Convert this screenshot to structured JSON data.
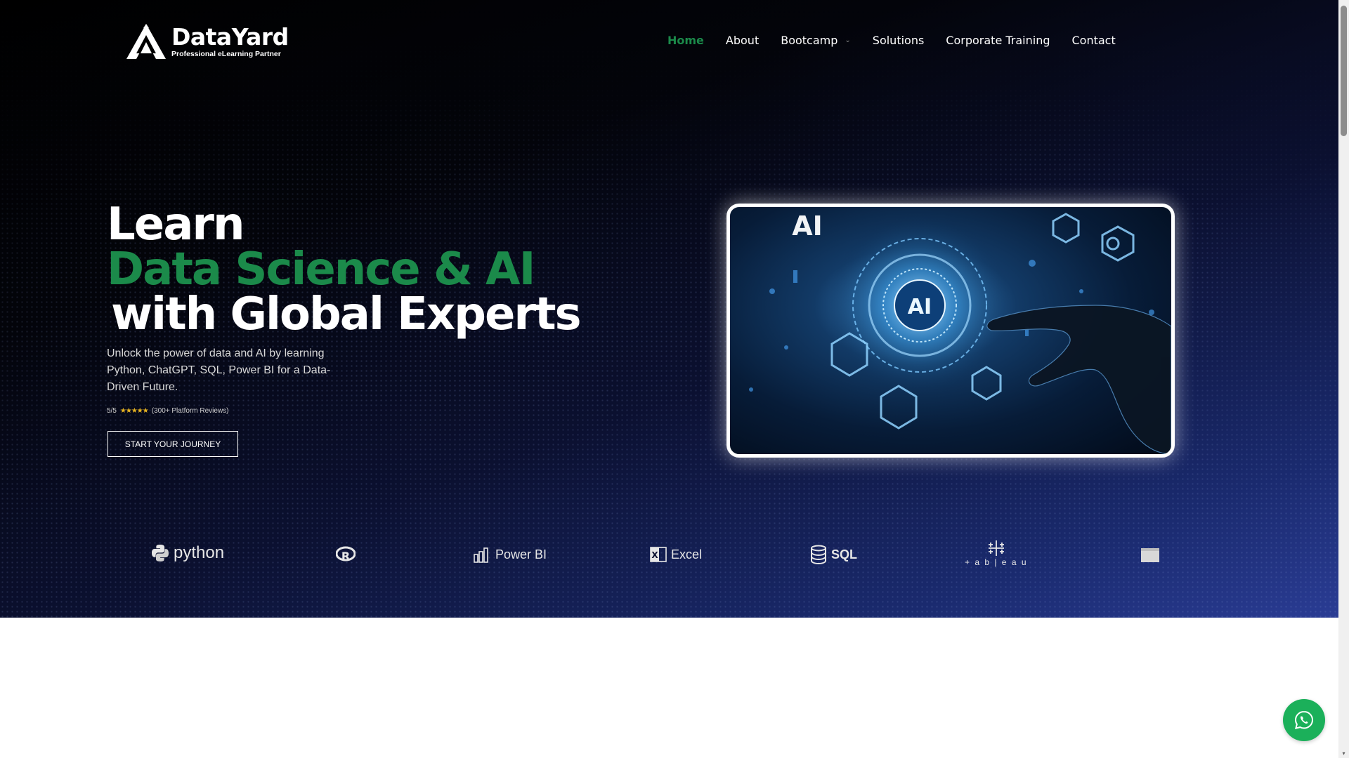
{
  "brand": {
    "name": "DataYard",
    "tagline": "Professional eLearning Partner"
  },
  "nav": {
    "items": [
      {
        "label": "Home",
        "active": true
      },
      {
        "label": "About"
      },
      {
        "label": "Bootcamp",
        "has_dropdown": true
      },
      {
        "label": "Solutions"
      },
      {
        "label": "Corporate Training"
      },
      {
        "label": "Contact"
      }
    ]
  },
  "hero": {
    "headline_line1": "Learn",
    "headline_line2": "Data Science & AI",
    "headline_line3": "with Global Experts",
    "subtext": "Unlock the power of data and AI by learning Python, ChatGPT, SQL, Power BI for a Data-Driven Future.",
    "rating": {
      "score": "5/5",
      "stars": "★★★★★",
      "reviews": "(300+ Platform Reviews)"
    },
    "cta_label": "START YOUR JOURNEY",
    "image_labels": {
      "top": "AI",
      "center": "AI"
    }
  },
  "tools": [
    {
      "label": "python",
      "icon": "python-icon"
    },
    {
      "label": "",
      "icon": "r-language-icon"
    },
    {
      "label": "Power BI",
      "icon": "power-bi-icon"
    },
    {
      "label": "Excel",
      "icon": "excel-icon"
    },
    {
      "label": "SQL",
      "icon": "sql-database-icon"
    },
    {
      "label": "+ a b | e a u",
      "icon": "tableau-icon"
    },
    {
      "label": "",
      "icon": "terminal-icon"
    }
  ],
  "colors": {
    "accent_green": "#1b8a4a",
    "hero_dark": "#000000",
    "hero_blue": "#2a3c94",
    "whatsapp_green": "#1bb05a",
    "star_gold": "#e6b422"
  }
}
